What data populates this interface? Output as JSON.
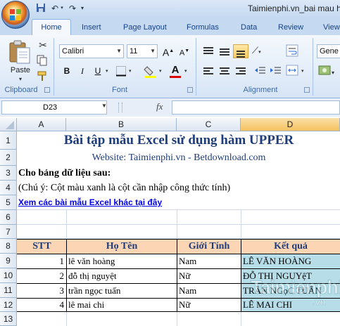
{
  "window": {
    "title": "Taimienphi.vn_bai mau h"
  },
  "tabs": [
    {
      "label": "Home"
    },
    {
      "label": "Insert"
    },
    {
      "label": "Page Layout"
    },
    {
      "label": "Formulas"
    },
    {
      "label": "Data"
    },
    {
      "label": "Review"
    },
    {
      "label": "View"
    }
  ],
  "ribbon": {
    "clipboard": {
      "paste_label": "Paste",
      "group_label": "Clipboard"
    },
    "font": {
      "font_name": "Calibri",
      "font_size": "11",
      "group_label": "Font",
      "bold": "B",
      "italic": "I",
      "underline": "U",
      "font_color_letter": "A",
      "grow": "A",
      "shrink": "A"
    },
    "alignment": {
      "group_label": "Alignment"
    },
    "number": {
      "format_value": "Gene"
    }
  },
  "formula_bar": {
    "name_box": "D23",
    "fx": "fx",
    "formula": ""
  },
  "columns": [
    "A",
    "B",
    "C",
    "D"
  ],
  "selected_column": "D",
  "rows": [
    "1",
    "2",
    "3",
    "4",
    "5",
    "6",
    "7",
    "8",
    "9",
    "10",
    "11",
    "12",
    "13"
  ],
  "sheet": {
    "title": "Bài tập mẫu Excel sử dụng hàm UPPER",
    "subtitle": "Website: Taimienphi.vn - Betdownload.com",
    "intro": "Cho bảng dữ liệu sau:",
    "note": "(Chú ý: Cột màu xanh là cột cần nhập công thức tính)",
    "link": "Xem các bài mẫu Excel khác tại đây",
    "table": {
      "headers": [
        "STT",
        "Họ Tên",
        "Giới Tính",
        "Kết quả"
      ],
      "rows": [
        [
          "1",
          "lê văn hoàng",
          "Nam",
          "LÊ VĂN HOÀNG"
        ],
        [
          "2",
          "đỗ thị nguyệt",
          "Nữ",
          "ĐỖ THỊ NGUYệT"
        ],
        [
          "3",
          "trần ngọc tuấn",
          "Nam",
          "TRẦN NGọC TUẤN"
        ],
        [
          "4",
          "lê mai chi",
          "Nữ",
          "LÊ MAI CHI"
        ]
      ]
    }
  },
  "watermark": {
    "text": "Taimienphi",
    "suffix": ".vn"
  },
  "colors": {
    "header_fill": "#fcd5b4",
    "result_fill": "#b7dee8",
    "title": "#1f3d7a",
    "link": "#0000ee"
  }
}
